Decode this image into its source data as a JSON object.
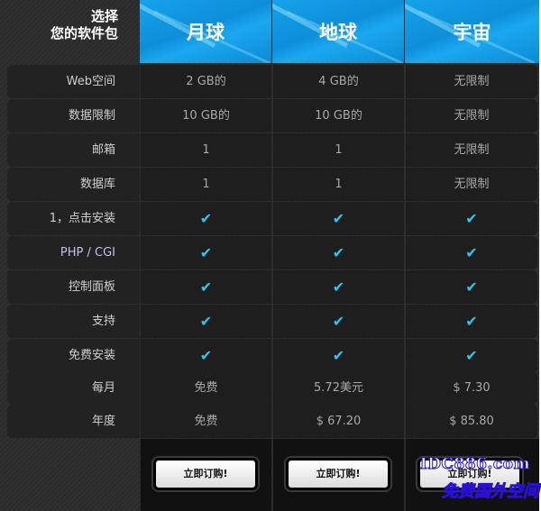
{
  "header": {
    "title_line1": "选择",
    "title_line2": "您的软件包",
    "plans": [
      "月球",
      "地球",
      "宇宙"
    ]
  },
  "rows": [
    {
      "label": "Web空间",
      "values": [
        "2 GB的",
        "4 GB的",
        "无限制"
      ]
    },
    {
      "label": "数据限制",
      "values": [
        "10 GB的",
        "10 GB的",
        "无限制"
      ]
    },
    {
      "label": "邮箱",
      "values": [
        "1",
        "1",
        "无限制"
      ]
    },
    {
      "label": "数据库",
      "values": [
        "1",
        "1",
        "无限制"
      ]
    },
    {
      "label": "1，点击安装",
      "values": [
        "✔",
        "✔",
        "✔"
      ]
    },
    {
      "label": "PHP / CGI",
      "values": [
        "✔",
        "✔",
        "✔"
      ]
    },
    {
      "label": "控制面板",
      "values": [
        "✔",
        "✔",
        "✔"
      ]
    },
    {
      "label": "支持",
      "values": [
        "✔",
        "✔",
        "✔"
      ]
    },
    {
      "label": "免费安装",
      "values": [
        "✔",
        "✔",
        "✔"
      ]
    },
    {
      "label": "每月",
      "values": [
        "免费",
        "5.72美元",
        "$ 7.30"
      ]
    },
    {
      "label": "年度",
      "values": [
        "免费",
        "$ 67.20",
        "$ 85.80"
      ]
    }
  ],
  "footer": {
    "order_labels": [
      "立即订购!",
      "立即订购!",
      "立即订购!"
    ]
  },
  "watermark": {
    "line1": "IDC886.com",
    "line2": "免费国外空间"
  },
  "colors": {
    "header_blue": "#0e8ed8",
    "check_color": "#2fc6ee",
    "accent_label": "#c7bdf0"
  }
}
